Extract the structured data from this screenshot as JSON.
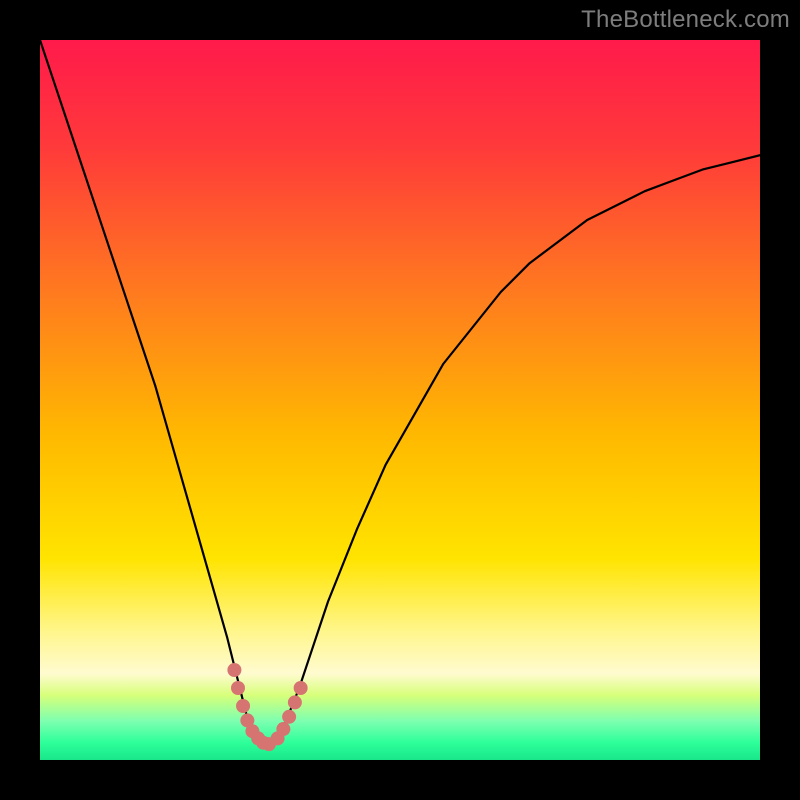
{
  "watermark": "TheBottleneck.com",
  "chart_data": {
    "type": "line",
    "title": "",
    "xlabel": "",
    "ylabel": "",
    "xlim": [
      0,
      100
    ],
    "ylim": [
      0,
      100
    ],
    "background_gradient_main": [
      {
        "stop": 0.0,
        "color": "#ff1a4b"
      },
      {
        "stop": 0.15,
        "color": "#ff3a3a"
      },
      {
        "stop": 0.35,
        "color": "#ff7a1f"
      },
      {
        "stop": 0.55,
        "color": "#ffb900"
      },
      {
        "stop": 0.72,
        "color": "#ffe400"
      },
      {
        "stop": 0.82,
        "color": "#fff68a"
      },
      {
        "stop": 0.88,
        "color": "#fffbd0"
      }
    ],
    "bottom_band_gradient": [
      {
        "stop": 0.0,
        "color": "#fffbd0"
      },
      {
        "stop": 0.25,
        "color": "#d7ff7a"
      },
      {
        "stop": 0.55,
        "color": "#7dffb0"
      },
      {
        "stop": 0.8,
        "color": "#2dff9a"
      },
      {
        "stop": 1.0,
        "color": "#19e68a"
      }
    ],
    "series": [
      {
        "name": "curve",
        "color": "#000000",
        "stroke_width": 2.2,
        "x": [
          0,
          2,
          4,
          6,
          8,
          10,
          12,
          14,
          16,
          18,
          20,
          22,
          24,
          26,
          27,
          28,
          29,
          30,
          31,
          32,
          33,
          34,
          36,
          38,
          40,
          44,
          48,
          52,
          56,
          60,
          64,
          68,
          72,
          76,
          80,
          84,
          88,
          92,
          96,
          100
        ],
        "y": [
          100,
          94,
          88,
          82,
          76,
          70,
          64,
          58,
          52,
          45,
          38,
          31,
          24,
          17,
          13,
          9,
          5,
          3,
          2,
          2,
          3,
          5,
          10,
          16,
          22,
          32,
          41,
          48,
          55,
          60,
          65,
          69,
          72,
          75,
          77,
          79,
          80.5,
          82,
          83,
          84
        ],
        "marker": {
          "color": "#d67472",
          "radius": 7,
          "x": [
            27.0,
            27.5,
            28.2,
            28.8,
            29.5,
            30.3,
            31.0,
            31.8,
            33.0,
            33.8,
            34.6,
            35.4,
            36.2
          ],
          "y": [
            12.5,
            10.0,
            7.5,
            5.5,
            4.0,
            3.0,
            2.4,
            2.2,
            3.0,
            4.3,
            6.0,
            8.0,
            10.0
          ]
        }
      }
    ]
  }
}
